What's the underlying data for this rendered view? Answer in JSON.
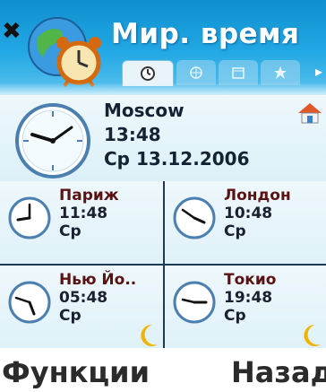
{
  "app": {
    "title": "Мир. время"
  },
  "tabs": [
    {
      "icon": "clock-icon",
      "active": true
    },
    {
      "icon": "globe-icon",
      "active": false
    },
    {
      "icon": "calendar-icon",
      "active": false
    },
    {
      "icon": "star-icon",
      "active": false
    }
  ],
  "home_city": {
    "name": "Moscow",
    "time": "13:48",
    "date": "Ср 13.12.2006"
  },
  "cities": [
    {
      "name": "Париж",
      "time": "11:48",
      "day": "Ср",
      "night": false
    },
    {
      "name": "Лондон",
      "time": "10:48",
      "day": "Ср",
      "night": false
    },
    {
      "name": "Нью Йо..",
      "time": "05:48",
      "day": "Ср",
      "night": true
    },
    {
      "name": "Токио",
      "time": "19:48",
      "day": "Ср",
      "night": true
    }
  ],
  "softkeys": {
    "left": "Функции",
    "right": "Назад"
  },
  "colors": {
    "header_blue": "#22a8e4",
    "panel_bg": "#eaf6fb",
    "divider": "#1b3b55",
    "moon": "#f0b400",
    "home_roof": "#e0582a"
  }
}
